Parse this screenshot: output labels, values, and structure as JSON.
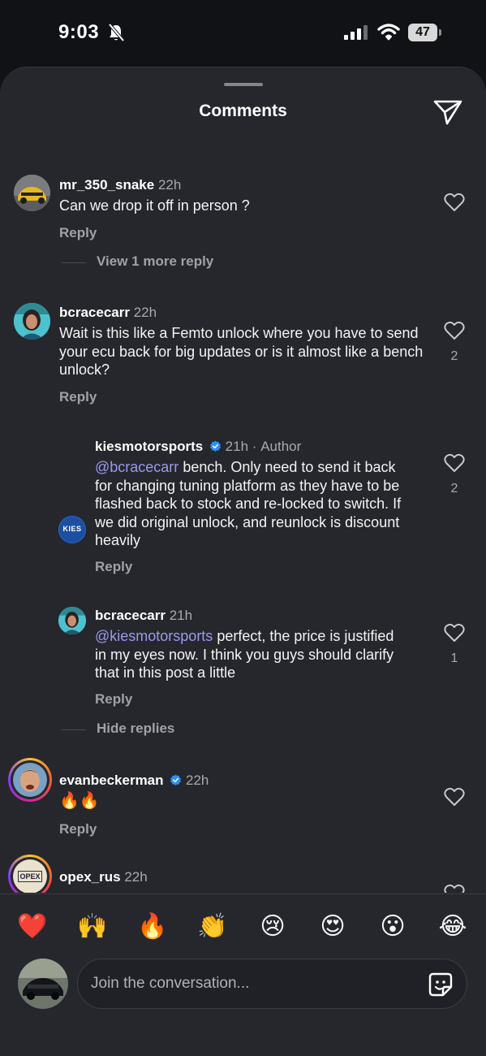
{
  "status_bar": {
    "time": "9:03",
    "battery": "47"
  },
  "sheet": {
    "title": "Comments"
  },
  "comments": [
    {
      "username": "mr_350_snake",
      "time": "22h",
      "text": "Can we drop it off in person ?",
      "reply_label": "Reply",
      "likes": "",
      "thread_link": "View 1 more reply"
    },
    {
      "username": "bcracecarr",
      "time": "22h",
      "text": "Wait is this like a Femto unlock where you have to send your ecu back for big updates or is it almost like a bench unlock?",
      "reply_label": "Reply",
      "likes": "2",
      "replies": [
        {
          "username": "kiesmotorsports",
          "time": "21h",
          "author_tag": "Author",
          "avatar_text": "KIES",
          "mention": "@bcracecarr",
          "text": " bench. Only need to send it back for changing tuning platform as they have to be flashed back to stock and re-locked to switch. If we did original unlock, and reunlock is discount heavily",
          "reply_label": "Reply",
          "likes": "2"
        },
        {
          "username": "bcracecarr",
          "time": "21h",
          "mention": "@kiesmotorsports",
          "text": " perfect, the price is justified in my eyes now. I think you guys should clarify that in this post a little",
          "reply_label": "Reply",
          "likes": "1"
        }
      ],
      "thread_link": "Hide replies"
    },
    {
      "username": "evanbeckerman",
      "time": "22h",
      "text": "🔥🔥",
      "reply_label": "Reply",
      "likes": ""
    },
    {
      "username": "opex_rus",
      "time": "22h",
      "avatar_text": "OPEX"
    }
  ],
  "emoji_bar": [
    "❤️",
    "🙌",
    "🔥",
    "👏",
    "😢",
    "😍",
    "😮",
    "😂"
  ],
  "composer": {
    "placeholder": "Join the conversation..."
  },
  "colors": {
    "sheet_bg": "#25272d",
    "mention": "#9a99f0",
    "verified": "#2f8ff5"
  }
}
